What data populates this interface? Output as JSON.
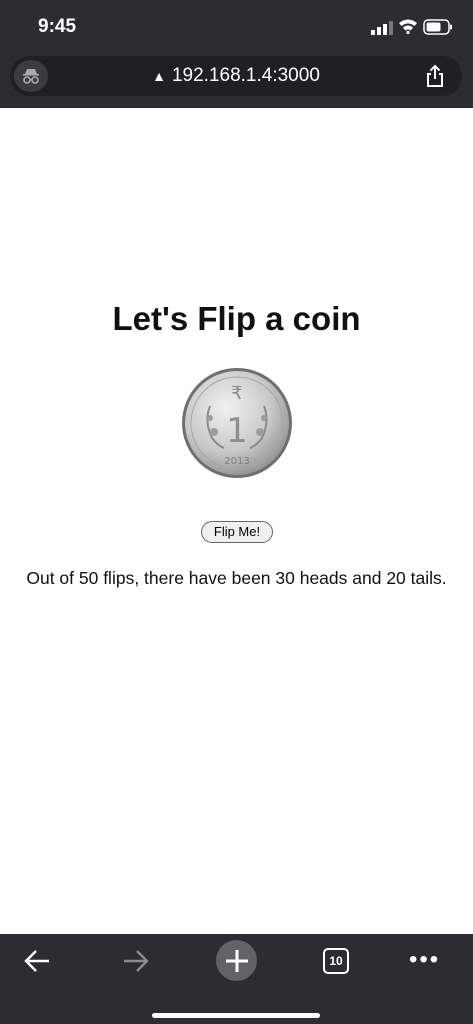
{
  "status": {
    "time": "9:45"
  },
  "browser": {
    "url": "192.168.1.4:3000",
    "tab_count": "10",
    "more_label": "•••"
  },
  "page": {
    "heading": "Let's Flip a coin",
    "coin_text": {
      "rupee": "₹",
      "value": "1",
      "year": "2013"
    },
    "button_label": "Flip Me!",
    "result_text": "Out of 50 flips, there have been 30 heads and 20 tails."
  },
  "colors": {
    "chrome_bg": "#2b2d30",
    "page_bg": "#ffffff",
    "coin_silver": "#c9cac7"
  },
  "icons": [
    "incognito-icon",
    "warning-icon",
    "share-icon",
    "back-arrow-icon",
    "forward-arrow-icon",
    "plus-icon",
    "tabs-icon",
    "more-icon"
  ]
}
